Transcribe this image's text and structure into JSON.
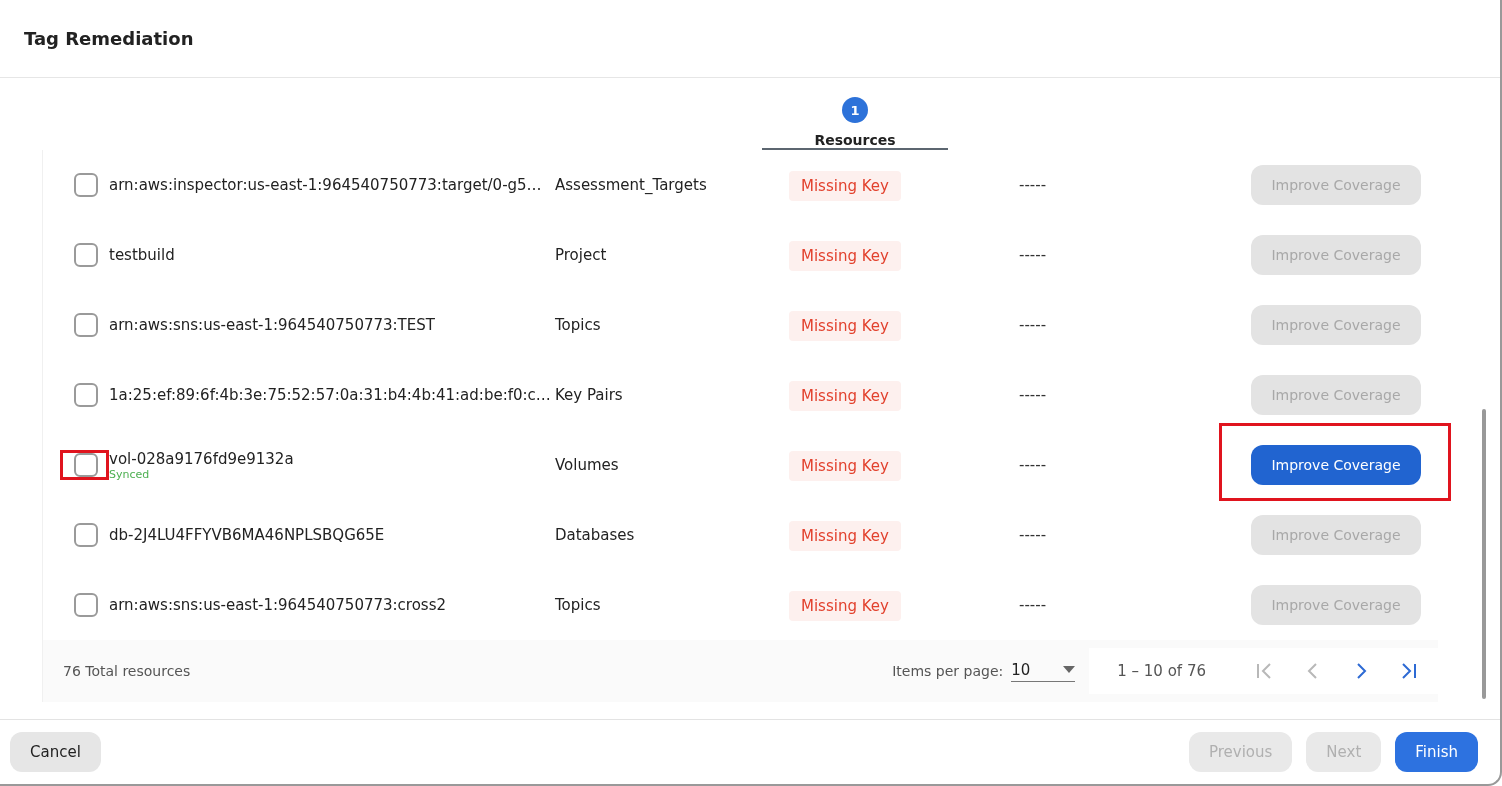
{
  "dialog": {
    "title": "Tag Remediation"
  },
  "stepper": {
    "steps": [
      {
        "number": "1",
        "label": "Resources",
        "selected": true
      }
    ]
  },
  "table": {
    "rows": [
      {
        "name": "arn:aws:inspector:us-east-1:964540750773:target/0-g5…",
        "type": "Assessment_Targets",
        "status": "Missing Key",
        "column_4": "-----",
        "action": {
          "label": "Improve Coverage",
          "disabled": true
        },
        "checked": false,
        "highlighted": false
      },
      {
        "name": "testbuild",
        "type": "Project",
        "status": "Missing Key",
        "column_4": "-----",
        "action": {
          "label": "Improve Coverage",
          "disabled": true
        },
        "checked": false,
        "highlighted": false
      },
      {
        "name": "arn:aws:sns:us-east-1:964540750773:TEST",
        "type": "Topics",
        "status": "Missing Key",
        "column_4": "-----",
        "action": {
          "label": "Improve Coverage",
          "disabled": true
        },
        "checked": false,
        "highlighted": false
      },
      {
        "name": "1a:25:ef:89:6f:4b:3e:75:52:57:0a:31:b4:4b:41:ad:be:f0:c…",
        "type": "Key Pairs",
        "status": "Missing Key",
        "column_4": "-----",
        "action": {
          "label": "Improve Coverage",
          "disabled": true
        },
        "checked": false,
        "highlighted": false
      },
      {
        "name": "vol-028a9176fd9e9132a",
        "sync": "Synced",
        "type": "Volumes",
        "status": "Missing Key",
        "column_4": "-----",
        "action": {
          "label": "Improve Coverage",
          "disabled": false
        },
        "checked": false,
        "highlighted": true
      },
      {
        "name": "db-2J4LU4FFYVB6MA46NPLSBQG65E",
        "type": "Databases",
        "status": "Missing Key",
        "column_4": "-----",
        "action": {
          "label": "Improve Coverage",
          "disabled": true
        },
        "checked": false,
        "highlighted": false
      },
      {
        "name": "arn:aws:sns:us-east-1:964540750773:cross2",
        "type": "Topics",
        "status": "Missing Key",
        "column_4": "-----",
        "action": {
          "label": "Improve Coverage",
          "disabled": true
        },
        "checked": false,
        "highlighted": false
      }
    ],
    "footer": {
      "total": "76 Total resources",
      "items_per_page_label": "Items per page:",
      "items_per_page": "10",
      "range": "1 – 10 of 76",
      "nav": [
        {
          "kind": "first",
          "disabled": true
        },
        {
          "kind": "prev",
          "disabled": true
        },
        {
          "kind": "next",
          "disabled": false
        },
        {
          "kind": "last",
          "disabled": false
        }
      ]
    }
  },
  "buttons": [
    {
      "label": "Cancel",
      "kind": "secondary",
      "disabled": false
    },
    {
      "label": "Previous",
      "kind": "secondary",
      "disabled": true
    },
    {
      "label": "Next",
      "kind": "secondary",
      "disabled": true
    },
    {
      "label": "Finish",
      "kind": "primary",
      "disabled": false
    }
  ]
}
